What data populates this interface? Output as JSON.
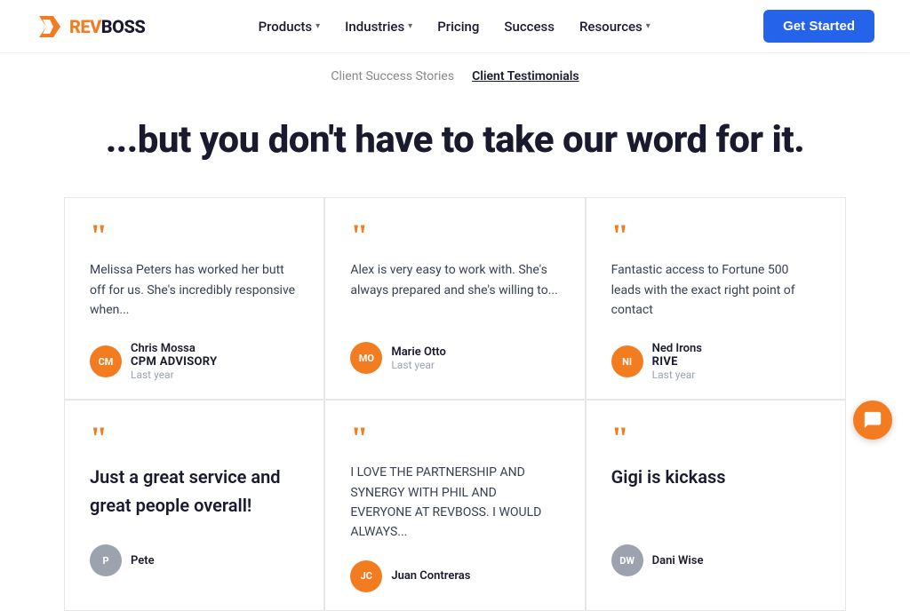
{
  "logo": {
    "brand_prefix": "REV",
    "brand_suffix": "BOSS",
    "icon_initials": "R"
  },
  "navbar": {
    "links": [
      {
        "label": "Products",
        "has_dropdown": true
      },
      {
        "label": "Industries",
        "has_dropdown": true
      },
      {
        "label": "Pricing",
        "has_dropdown": false
      },
      {
        "label": "Success",
        "has_dropdown": false
      },
      {
        "label": "Resources",
        "has_dropdown": true
      }
    ],
    "cta_label": "Get Started"
  },
  "breadcrumb": {
    "items": [
      {
        "label": "Client Success Stories",
        "active": false
      },
      {
        "label": "Client Testimonials",
        "active": true
      }
    ]
  },
  "hero": {
    "headline": "...but you don't have to take our word for it."
  },
  "testimonials": [
    {
      "text": "Melissa Peters has worked her butt off for us. She's incredibly responsive when...",
      "author": {
        "initials": "CM",
        "name": "Chris Mossa",
        "company": "CPM Advisory",
        "time": "Last year"
      }
    },
    {
      "text": "Alex is very easy to work with. She's always prepared and she's willing to...",
      "author": {
        "initials": "MO",
        "name": "Marie Otto",
        "company": "",
        "time": "Last year"
      }
    },
    {
      "text": "Fantastic access to Fortune 500 leads with the exact right point of contact",
      "author": {
        "initials": "NI",
        "name": "Ned Irons",
        "company": "RIVE",
        "time": "Last year"
      }
    },
    {
      "text": "Just a great service and great people overall!",
      "author": {
        "initials": "P",
        "name": "Pete",
        "company": "",
        "time": ""
      }
    },
    {
      "text": "I LOVE THE PARTNERSHIP AND SYNERGY WITH PHIL AND EVERYONE AT REVBOSS. I WOULD ALWAYS...",
      "author": {
        "initials": "JC",
        "name": "Juan Contreras",
        "company": "",
        "time": ""
      }
    },
    {
      "text": "Gigi is kickass",
      "author": {
        "initials": "DW",
        "name": "Dani Wise",
        "company": "",
        "time": ""
      }
    }
  ]
}
